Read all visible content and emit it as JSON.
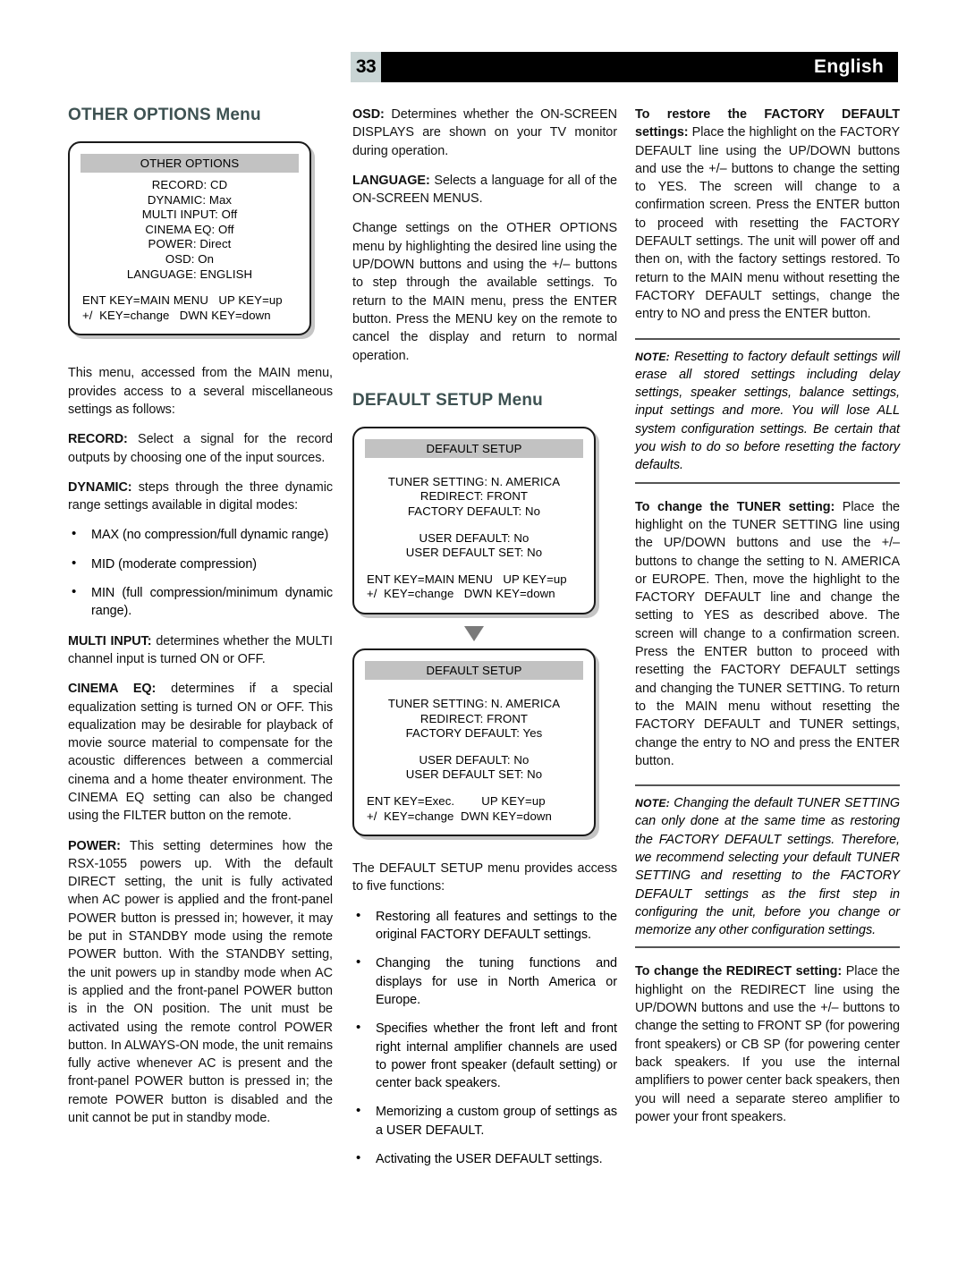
{
  "header": {
    "page_number": "33",
    "language": "English",
    "page_number_bg": "#c9d4d4",
    "bar_bg": "#000000"
  },
  "theme": {
    "heading_color": "#3e5252",
    "osd_title_bg": "#c2c2c2",
    "arrow_color": "#7a7a7a"
  },
  "col1": {
    "section_title": "OTHER OPTIONS Menu",
    "osd_other_options": {
      "title": "OTHER OPTIONS",
      "lines": [
        "RECORD: CD",
        "DYNAMIC: Max",
        "MULTI INPUT: Off",
        "CINEMA EQ: Off",
        "POWER: Direct",
        "OSD: On",
        "LANGUAGE: ENGLISH"
      ],
      "footer_line1": "ENT KEY=MAIN MENU   UP KEY=up",
      "footer_line2": "+/  KEY=change   DWN KEY=down"
    },
    "p_intro": "This menu, accessed from the MAIN menu, provides access to a several miscellaneous settings as follows:",
    "p_record_label": "RECORD:",
    "p_record": " Select a signal for the record outputs by choosing one of the input sources.",
    "p_dynamic_label": "DYNAMIC:",
    "p_dynamic": " steps through the three dynamic range settings available in digital modes:",
    "dynamic_bullets": [
      "MAX (no compression/full dynamic range)",
      "MID (moderate compression)",
      "MIN (full compression/minimum dynamic range)."
    ],
    "p_multi_label": "MULTI INPUT:",
    "p_multi": " determines whether the MULTI channel input is turned ON or OFF.",
    "p_cinema_label": "CINEMA EQ:",
    "p_cinema": " determines if a special equalization setting is turned ON or OFF. This equalization may be desirable for playback of movie source material to compensate for the acoustic differences between a commercial cinema and a home theater environment. The CINEMA EQ setting can also be changed using the FILTER button on the remote.",
    "p_power_label": "POWER:",
    "p_power": " This setting determines how the RSX-1055 powers up. With the default DIRECT setting, the unit is fully activated when AC power is applied and the front-panel POWER button is pressed in; however, it may be put in STANDBY mode using the remote POWER button. With the STANDBY setting, the unit powers up in standby mode when AC is applied and the front-panel POWER button is in the ON position. The unit must be activated using the remote control POWER button. In ALWAYS-ON mode, the unit remains fully active whenever AC is present and the front-panel POWER button is pressed in; the remote POWER button is disabled and the unit cannot be put in standby mode."
  },
  "col2": {
    "p_osd_label": "OSD:",
    "p_osd": " Determines whether the ON-SCREEN DISPLAYS are shown on your TV monitor during operation.",
    "p_language_label": "LANGUAGE:",
    "p_language": " Selects a language for all of the ON-SCREEN MENUS.",
    "p_change": "Change settings on the OTHER OPTIONS menu by highlighting the desired line using the UP/DOWN buttons and using the +/– buttons to step through the available settings. To return to the MAIN menu, press the ENTER button. Press the MENU key on the remote to cancel the display and return to normal operation.",
    "section_title": "DEFAULT SETUP Menu",
    "osd_default_setup_1": {
      "title": "DEFAULT SETUP",
      "lines_group1": [
        "TUNER SETTING: N. AMERICA",
        "REDIRECT: FRONT",
        "FACTORY DEFAULT: No"
      ],
      "lines_group2": [
        "USER DEFAULT: No",
        "USER DEFAULT SET: No"
      ],
      "footer_line1": "ENT KEY=MAIN MENU   UP KEY=up",
      "footer_line2": "+/  KEY=change   DWN KEY=down"
    },
    "arrow_icon": "chevron-down-icon",
    "osd_default_setup_2": {
      "title": "DEFAULT SETUP",
      "lines_group1": [
        "TUNER SETTING: N. AMERICA",
        "REDIRECT: FRONT",
        "FACTORY DEFAULT: Yes"
      ],
      "lines_group2": [
        "USER DEFAULT: No",
        "USER DEFAULT SET: No"
      ],
      "footer_line1": "ENT KEY=Exec.        UP KEY=up",
      "footer_line2": "+/  KEY=change  DWN KEY=down"
    },
    "p_five": "The DEFAULT SETUP menu provides access to five functions:",
    "function_bullets": [
      "Restoring all features and settings to the original FACTORY DEFAULT settings.",
      "Changing the tuning functions and displays for use in North America or Europe.",
      "Specifies whether the front left and front right internal amplifier channels are used to power front speaker (default setting) or center back speakers.",
      "Memorizing a custom group of settings as a USER DEFAULT.",
      "Activating the USER DEFAULT settings."
    ]
  },
  "col3": {
    "p_restore_label": "To restore the FACTORY DEFAULT settings:",
    "p_restore": " Place the highlight on the FACTORY DEFAULT line using the UP/DOWN buttons and use the +/– buttons to change the setting to YES. The screen will change to a confirmation screen. Press the ENTER button to proceed with resetting the FACTORY DEFAULT settings. The unit will power off and then on, with the factory settings restored. To return to the MAIN menu without resetting the FACTORY DEFAULT settings, change the entry to NO and press the ENTER button.",
    "note1_label": "NOTE:",
    "note1": " Resetting to factory default settings will erase all stored settings including delay settings, speaker settings, balance settings, input settings and more. You will lose ALL system configuration settings. Be certain that you wish to do so before resetting the factory defaults.",
    "p_tuner_label": "To change the TUNER setting:",
    "p_tuner": " Place the highlight on the TUNER SETTING line using the UP/DOWN buttons and use the +/– buttons to change the setting to N. AMERICA or EUROPE. Then, move the highlight to the FACTORY DEFAULT line and change the setting to YES as described above. The screen will change to a confirmation screen. Press the ENTER button to proceed with resetting the FACTORY DEFAULT settings and changing the TUNER SETTING. To return to the MAIN menu without resetting the FACTORY DEFAULT and TUNER settings, change the entry to NO and press the ENTER button.",
    "note2_label": "NOTE:",
    "note2": " Changing the default TUNER SETTING can only done at the same time as restoring the FACTORY DEFAULT settings. Therefore, we recommend selecting your default TUNER SETTING and resetting to the FACTORY DEFAULT settings as the first step in configuring the unit, before you change or memorize any other configuration settings.",
    "p_redirect_label": "To change the REDIRECT setting:",
    "p_redirect": " Place the highlight on the REDIRECT line using the UP/DOWN buttons and use the +/– buttons to change the setting to FRONT SP (for powering front speakers) or CB SP (for powering center back speakers. If you use the internal amplifiers to power center back speakers, then you will need a separate stereo amplifier to power your front speakers."
  }
}
